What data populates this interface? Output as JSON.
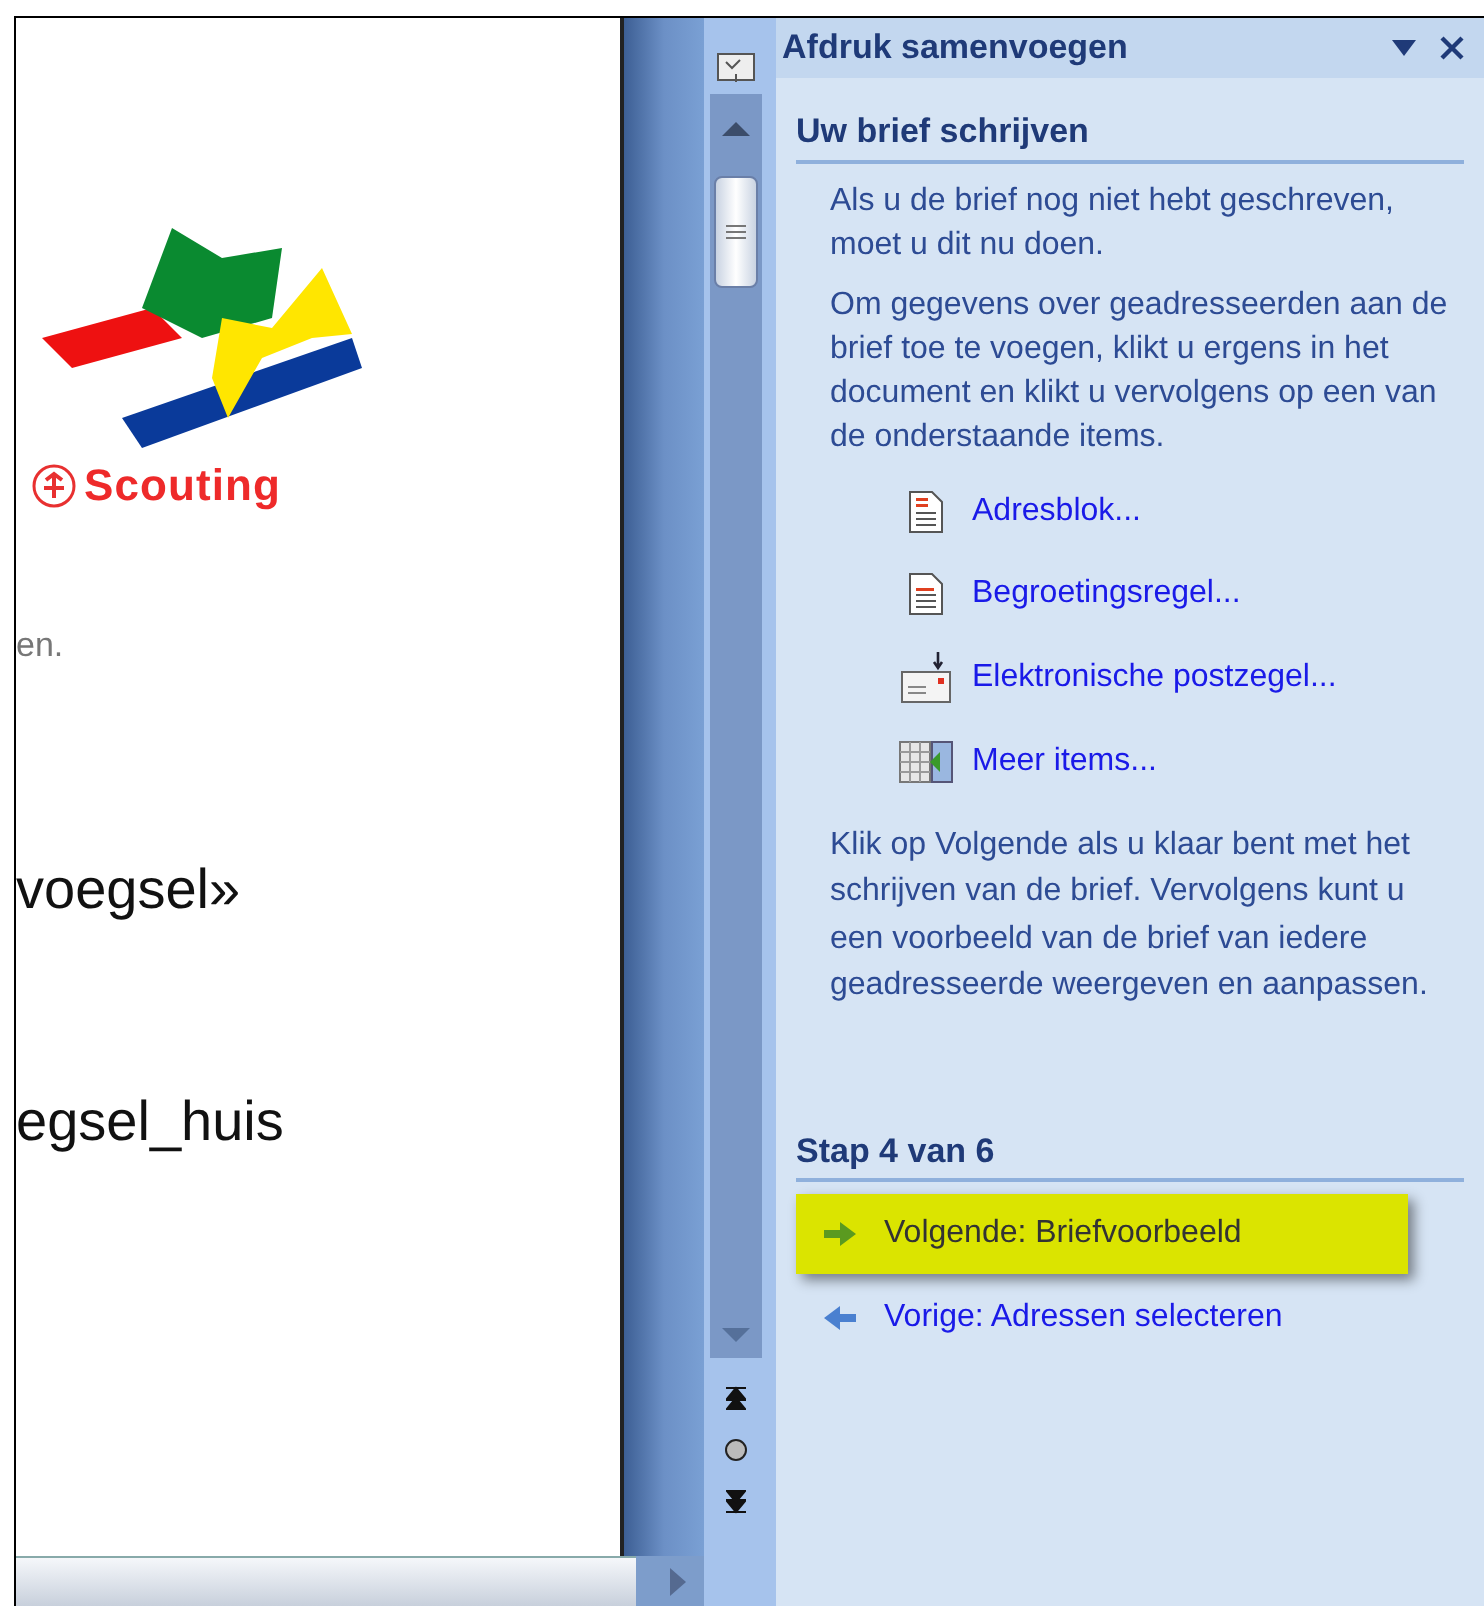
{
  "document": {
    "logo_text": "Scouting",
    "lines": [
      {
        "kind": "small",
        "text": "en."
      },
      {
        "kind": "large",
        "text": "voegsel»"
      },
      {
        "kind": "large",
        "text": "egsel_huis"
      }
    ]
  },
  "task_pane": {
    "title": "Afdruk samenvoegen",
    "section_title": "Uw brief schrijven",
    "paragraphs": [
      "Als u de brief nog niet hebt geschreven, moet u dit nu doen.",
      "Om gegevens over geadresseerden aan de brief toe te voegen, klikt u ergens in het document en klikt u vervolgens op een van de onderstaande items."
    ],
    "links": [
      {
        "kind": "address",
        "label": "Adresblok..."
      },
      {
        "kind": "greeting",
        "label": "Begroetingsregel..."
      },
      {
        "kind": "postage",
        "label": "Elektronische postzegel..."
      },
      {
        "kind": "more",
        "label": "Meer items..."
      }
    ],
    "footer_text": "Klik op Volgende als u klaar bent met het schrijven van de brief. Vervolgens kunt u een voorbeeld van de brief van iedere geadresseerde weergeven en aanpassen.",
    "step_title": "Stap 4 van 6",
    "nav": [
      {
        "kind": "next",
        "label": "Volgende: Briefvoorbeeld",
        "selected": true
      },
      {
        "kind": "back",
        "label": "Vorige: Adressen selecteren",
        "selected": false
      }
    ]
  }
}
